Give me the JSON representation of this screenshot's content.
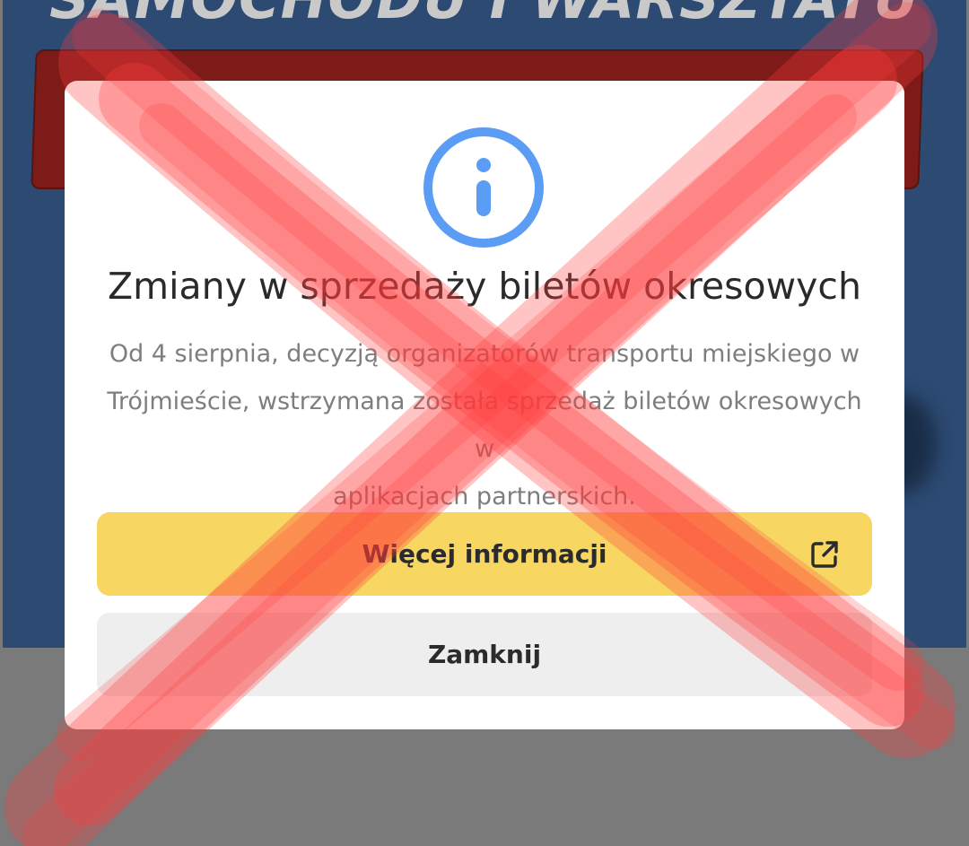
{
  "background": {
    "headline": "SAMOCHODU I WARSZTATU"
  },
  "modal": {
    "icon": "info-icon",
    "title": "Zmiany w sprzedaży biletów okresowych",
    "message_lines": [
      "Od 4 sierpnia, decyzją organizatorów transportu miejskiego w",
      "Trójmieście, wstrzymana została sprzedaż biletów okresowych w",
      "aplikacjach partnerskich."
    ],
    "more_info_button": {
      "label": "Więcej informacji",
      "icon": "external-link-icon"
    },
    "close_button": {
      "label": "Zamknij"
    }
  },
  "overlay": {
    "icon": "red-x-cross-mark"
  },
  "colors": {
    "accent_yellow": "#f7d662",
    "info_blue": "#5b9cf5",
    "close_gray": "#eeeeee",
    "overlay_red": "#ff3b3b"
  }
}
